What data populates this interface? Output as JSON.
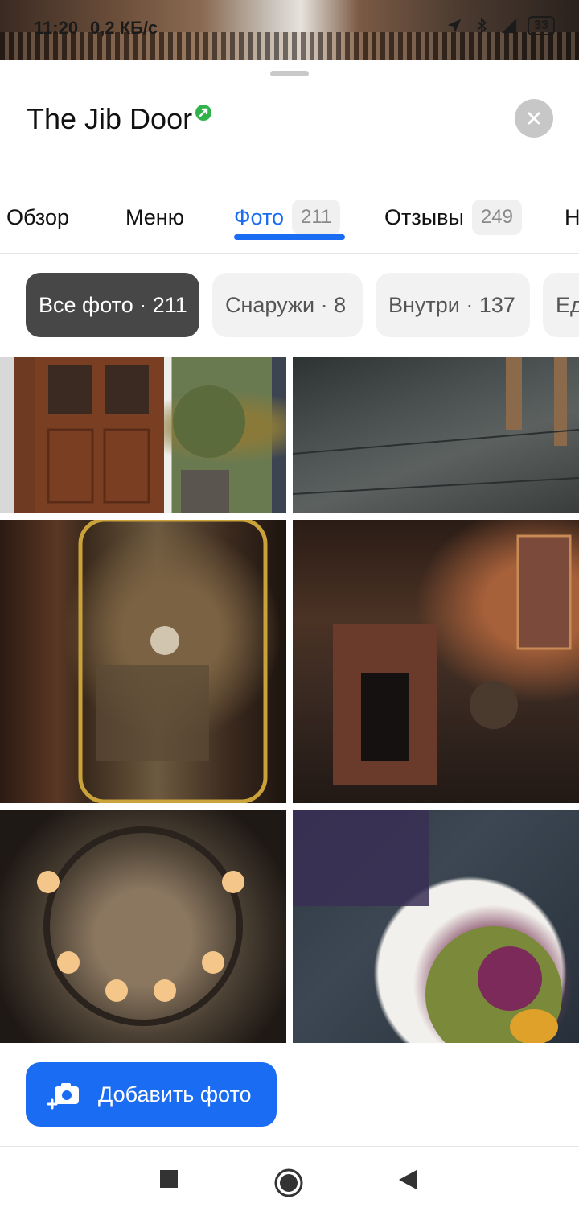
{
  "status_bar": {
    "time": "11:20",
    "speed": "0,2 КБ/с",
    "battery": "33",
    "icons": [
      "alarm-icon",
      "vpn-icon",
      "layers-icon",
      "location-icon",
      "bluetooth-icon",
      "volte-icon",
      "signal-icon"
    ]
  },
  "place": {
    "title": "The Jib Door",
    "verified_icon": "verified-badge-icon"
  },
  "tabs": [
    {
      "label": "Обзор",
      "count": ""
    },
    {
      "label": "Меню",
      "count": ""
    },
    {
      "label": "Фото",
      "count": "211",
      "active": true
    },
    {
      "label": "Отзывы",
      "count": "249"
    },
    {
      "label": "Н",
      "count": ""
    }
  ],
  "filters": [
    {
      "label": "Все фото · 211",
      "active": true
    },
    {
      "label": "Снаружи · 8"
    },
    {
      "label": "Внутри · 137"
    },
    {
      "label": "Ед"
    }
  ],
  "photos": [
    {
      "name": "photo-entrance-door"
    },
    {
      "name": "photo-floor"
    },
    {
      "name": "photo-window-zedel"
    },
    {
      "name": "photo-fireplace-interior"
    },
    {
      "name": "photo-chandelier"
    },
    {
      "name": "photo-salad-dish"
    }
  ],
  "actions": {
    "add_photo_label": "Добавить фото"
  },
  "colors": {
    "accent": "#1a6cf2",
    "active_chip": "#474747"
  }
}
